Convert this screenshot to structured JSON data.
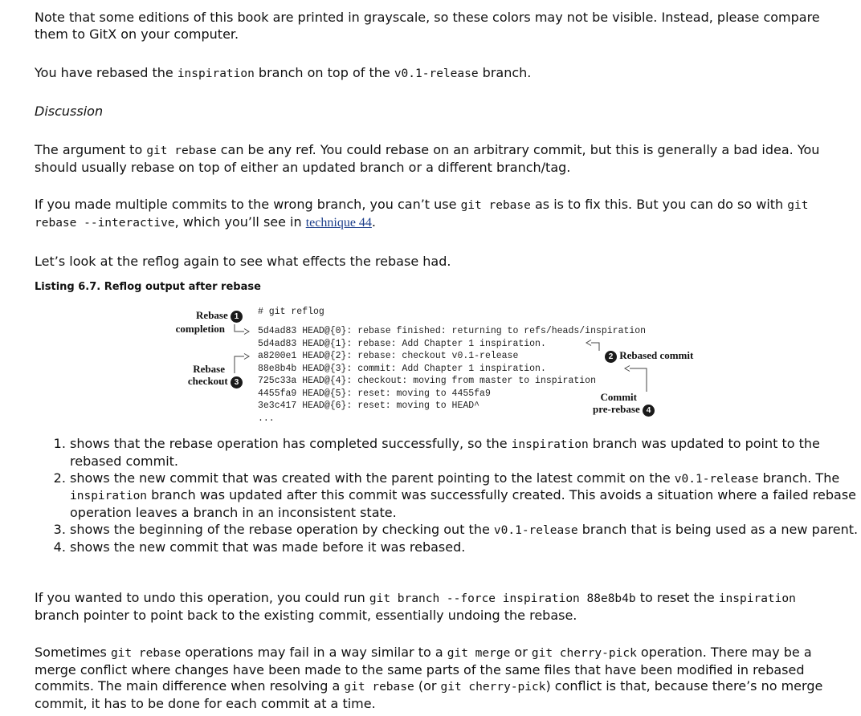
{
  "para1": "Note that some editions of this book are printed in grayscale, so these colors may not be visible. Instead, please compare them to GitX on your computer.",
  "para2": {
    "t1": "You have rebased the ",
    "c1": "inspiration",
    "t2": " branch on top of the ",
    "c2": "v0.1-release",
    "t3": " branch."
  },
  "discussion_heading": "Discussion",
  "para3": {
    "t1": "The argument to ",
    "c1": "git rebase",
    "t2": " can be any ref. You could rebase on an arbitrary commit, but this is generally a bad idea. You should usually rebase on top of either an updated branch or a different branch/tag."
  },
  "para4": {
    "t1": "If you made multiple commits to the wrong branch, you can’t use ",
    "c1": "git rebase",
    "t2": " as is to fix this. But you can do so with ",
    "c2": "git rebase --interactive",
    "t3": ", which you’ll see in ",
    "link": "technique 44",
    "t4": "."
  },
  "para5": "Let’s look at the reflog again to see what effects the rebase had.",
  "listing_title": "Listing 6.7. Reflog output after rebase",
  "code_lines": [
    "# git reflog",
    "5d4ad83 HEAD@{0}: rebase finished: returning to refs/heads/inspiration",
    "5d4ad83 HEAD@{1}: rebase: Add Chapter 1 inspiration.",
    "a8200e1 HEAD@{2}: rebase: checkout v0.1-release",
    "88e8b4b HEAD@{3}: commit: Add Chapter 1 inspiration.",
    "725c33a HEAD@{4}: checkout: moving from master to inspiration",
    "4455fa9 HEAD@{5}: reset: moving to 4455fa9",
    "3e3c417 HEAD@{6}: reset: moving to HEAD^",
    "..."
  ],
  "callouts": {
    "c1": {
      "line1": "Rebase",
      "line2": "completion",
      "num": "1"
    },
    "c2": {
      "text": "Rebased commit",
      "num": "2"
    },
    "c3": {
      "line1": "Rebase",
      "line2": "checkout",
      "num": "3"
    },
    "c4": {
      "line1": "Commit",
      "line2": "pre-rebase",
      "num": "4"
    }
  },
  "list_items": [
    {
      "t1": "shows that the rebase operation has completed successfully, so the ",
      "c1": "inspiration",
      "t2": " branch was updated to point to the rebased commit."
    },
    {
      "t1": "shows the new commit that was created with the parent pointing to the latest commit on the ",
      "c1": "v0.1-release",
      "t2": " branch. The ",
      "c2": "inspiration",
      "t3": " branch was updated after this commit was successfully created. This avoids a situation where a failed rebase operation leaves a branch in an inconsistent state."
    },
    {
      "t1": "shows the beginning of the rebase operation by checking out the ",
      "c1": "v0.1-release",
      "t2": " branch that is being used as a new parent."
    },
    {
      "t1": "shows the new commit that was made before it was rebased."
    }
  ],
  "para6": {
    "t1": "If you wanted to undo this operation, you could run ",
    "c1": "git branch --force inspiration 88e8b4b",
    "t2": " to reset the ",
    "c2": "inspiration",
    "t3": " branch pointer to point back to the existing commit, essentially undoing the rebase."
  },
  "para7": {
    "t1": "Sometimes ",
    "c1": "git rebase",
    "t2": " operations may fail in a way similar to a ",
    "c2": "git merge",
    "t3": " or ",
    "c3": "git cherry-pick",
    "t4": " operation. There may be a merge conflict where changes have been made to the same parts of the same files that have been modified in rebased commits. The main difference when resolving a ",
    "c4": "git rebase",
    "t5": " (or ",
    "c5": "git cherry-pick",
    "t6": ") conflict is that, because there’s no merge commit, it has to be done for each commit at a time."
  }
}
